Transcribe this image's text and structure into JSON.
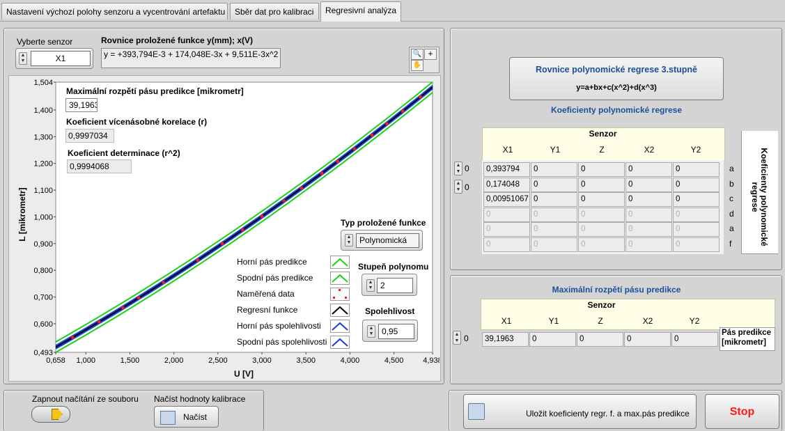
{
  "tabs": [
    "Nastavení výchozí polohy senzoru a vycentrování artefaktu",
    "Sběr dat pro kalibraci",
    "Regresivní analýza"
  ],
  "left": {
    "sensor_label": "Vyberte senzor",
    "sensor_value": "X1",
    "equation_label": "Rovnice proložené funkce y(mm); x(V)",
    "equation_value": "y = +393,794E-3 + 174,048E-3x + 9,511E-3x^2",
    "max_band_label": "Maximální rozpětí pásu predikce [mikrometr]",
    "max_band_value": "39,1963",
    "r_label": "Koeficient vícenásobné korelace (r)",
    "r_value": "0,9997034",
    "r2_label": "Koeficient determinace (r^2)",
    "r2_value": "0,9994068",
    "fit_type_label": "Typ proložené funkce",
    "fit_type_value": "Polynomická",
    "degree_label": "Stupeň polynomu",
    "degree_value": "2",
    "conf_label": "Spolehlivost",
    "conf_value": "0,95",
    "legend": [
      "Horní pás predikce",
      "Spodní pás predikce",
      "Naměřená data",
      "Regresní funkce",
      "Horní pás spolehlivosti",
      "Spodní pás spolehlivosti"
    ]
  },
  "chart_data": {
    "type": "line",
    "xlabel": "U [V]",
    "ylabel": "L [mikrometr]",
    "xlim": [
      0.658,
      4.938
    ],
    "ylim": [
      0.493,
      1.504
    ],
    "x_ticks": [
      "0,658",
      "1,000",
      "1,500",
      "2,000",
      "2,500",
      "3,000",
      "3,500",
      "4,000",
      "4,500",
      "4,938"
    ],
    "y_ticks": [
      "1,504",
      "1,400",
      "1,300",
      "1,200",
      "1,100",
      "1,000",
      "0,900",
      "0,800",
      "0,700",
      "0,600",
      "0,493"
    ],
    "regression": {
      "a": 0.393794,
      "b": 0.174048,
      "c": 0.009511
    },
    "band": 0.0196,
    "measured_x": [
      0.85,
      1.15,
      1.42,
      1.6,
      1.88,
      2.27,
      2.55,
      2.78,
      3.0,
      3.25,
      3.45,
      3.68,
      3.86,
      4.05,
      4.25,
      4.42,
      4.6,
      4.8,
      4.95
    ],
    "colors": {
      "prediction": "#19d219",
      "measured": "#ff1a1a",
      "regression": "#000000",
      "confidence": "#1a3fc6"
    }
  },
  "right": {
    "title1": "Rovnice polynomické regrese 3.stupně",
    "subtitle1": "y=a+bx+c(x^2)+d(x^3)",
    "coef_title": "Koeficienty polynomické regrese",
    "senzor_header": "Senzor",
    "columns": [
      "X1",
      "Y1",
      "Z",
      "X2",
      "Y2"
    ],
    "index1": "0",
    "index2": "0",
    "rows": [
      [
        "0,393794",
        "0",
        "0",
        "0",
        "0"
      ],
      [
        "0,174048",
        "0",
        "0",
        "0",
        "0"
      ],
      [
        "0,00951067",
        "0",
        "0",
        "0",
        "0"
      ],
      [
        "0",
        "0",
        "0",
        "0",
        "0"
      ],
      [
        "0",
        "0",
        "0",
        "0",
        "0"
      ],
      [
        "0",
        "0",
        "0",
        "0",
        "0"
      ]
    ],
    "row_labels": [
      "a",
      "b",
      "c",
      "d",
      "a",
      "f"
    ],
    "side_label": "Koeficienty polynomické regrese",
    "max_title": "Maximální rozpětí pásu predikce",
    "max_senzor": "Senzor",
    "max_index": "0",
    "max_row": [
      "39,1963",
      "0",
      "0",
      "0",
      "0"
    ],
    "max_side_label": "Pás predikce [mikrometr]"
  },
  "bottom": {
    "load_toggle_label": "Zapnout načítání ze souboru",
    "load_values_label": "Načíst hodnoty kalibrace",
    "load_button": "Načíst",
    "save_button": "Uložit koeficienty regr. f. a max.pás predikce",
    "stop_button": "Stop"
  }
}
